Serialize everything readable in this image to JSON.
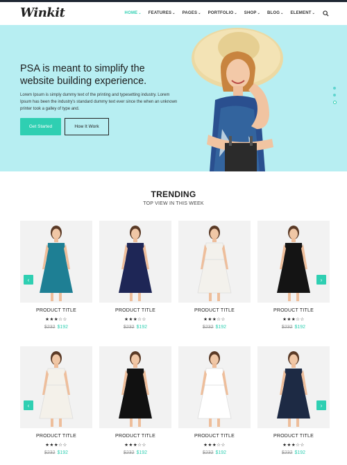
{
  "header": {
    "logo": "Winkit",
    "nav": [
      {
        "label": "HOME"
      },
      {
        "label": "FEATURES"
      },
      {
        "label": "PAGES"
      },
      {
        "label": "PORTFOLIO"
      },
      {
        "label": "SHOP"
      },
      {
        "label": "BLOG"
      },
      {
        "label": "ELEMENT"
      }
    ],
    "active_index": 0
  },
  "hero": {
    "title": "PSA is meant to simplify the website building experience.",
    "text": "Lorem Ipsum is simply dummy text of the printing and typesetting industry. Lorem Ipsum has been the industry's standard dummy text ever since the when an unknown printer took a galley of type and.",
    "primary_button": "Get Started",
    "secondary_button": "How It Work",
    "slides": 3,
    "active_slide": 3
  },
  "trending": {
    "title": "TRENDING",
    "subtitle": "TOP VIEW IN THIS WEEK",
    "rows": [
      [
        {
          "name": "PRODUCT TITLE",
          "stars": "★★★☆☆",
          "old_price": "$232",
          "new_price": "$192",
          "dress_color": "#1e7f94"
        },
        {
          "name": "PRODUCT TITLE",
          "stars": "★★★☆☆",
          "old_price": "$232",
          "new_price": "$192",
          "dress_color": "#1e2656"
        },
        {
          "name": "PRODUCT TITLE",
          "stars": "★★★☆☆",
          "old_price": "$232",
          "new_price": "$192",
          "dress_color": "#f3f1ec"
        },
        {
          "name": "PRODUCT TITLE",
          "stars": "★★★☆☆",
          "old_price": "$232",
          "new_price": "$192",
          "dress_color": "#141414"
        }
      ],
      [
        {
          "name": "PRODUCT TITLE",
          "stars": "★★★☆☆",
          "old_price": "$232",
          "new_price": "$192",
          "dress_color": "#f4f1ea"
        },
        {
          "name": "PRODUCT TITLE",
          "stars": "★★★☆☆",
          "old_price": "$232",
          "new_price": "$192",
          "dress_color": "#111111"
        },
        {
          "name": "PRODUCT TITLE",
          "stars": "★★★☆☆",
          "old_price": "$232",
          "new_price": "$192",
          "dress_color": "#ffffff"
        },
        {
          "name": "PRODUCT TITLE",
          "stars": "★★★☆☆",
          "old_price": "$232",
          "new_price": "$192",
          "dress_color": "#1d2a44"
        }
      ]
    ]
  },
  "colors": {
    "accent": "#2fcfb2",
    "hero_bg": "#b7eef2",
    "dark": "#1f2733"
  },
  "icons": {
    "search": "search-icon",
    "prev": "chevron-left-icon",
    "next": "chevron-right-icon"
  }
}
